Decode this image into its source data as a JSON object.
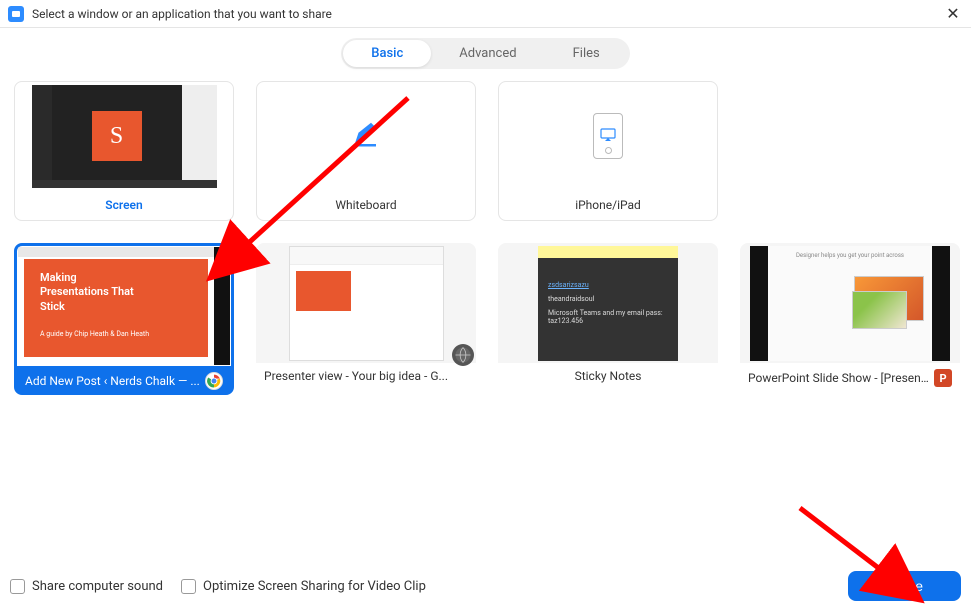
{
  "titlebar": {
    "title": "Select a window or an application that you want to share"
  },
  "tabs": {
    "basic": "Basic",
    "advanced": "Advanced",
    "files": "Files",
    "active": "basic"
  },
  "options": {
    "screen": {
      "label": "Screen",
      "icon_letter": "S"
    },
    "whiteboard": {
      "label": "Whiteboard"
    },
    "iphone": {
      "label": "iPhone/iPad"
    }
  },
  "windows": [
    {
      "id": "chrome",
      "label": "Add New Post ‹ Nerds Chalk — ...",
      "app": "chrome",
      "selected": true,
      "slide_title": "Making\nPresentations That\nStick",
      "slide_sub": "A guide by Chip Heath & Dan Heath"
    },
    {
      "id": "presenter",
      "label": "Presenter view - Your big idea - G...",
      "app": "globe",
      "selected": false
    },
    {
      "id": "sticky",
      "label": "Sticky Notes",
      "app": "",
      "selected": false,
      "sticky_link": "zsdsarizsazu",
      "sticky_user": "theandraidsoul",
      "sticky_text": "Microsoft Teams and my email pass:",
      "sticky_pass": "taz123.456"
    },
    {
      "id": "powerpoint",
      "label": "PowerPoint Slide Show - [Present...",
      "app": "powerpoint",
      "selected": false,
      "ppt_tagline": "Designer helps you get your point across"
    }
  ],
  "footer": {
    "share_sound": "Share computer sound",
    "optimize": "Optimize Screen Sharing for Video Clip",
    "share_button": "Share"
  },
  "colors": {
    "primary": "#0E71EB",
    "accent_orange": "#e8572e",
    "powerpoint": "#D24726"
  }
}
